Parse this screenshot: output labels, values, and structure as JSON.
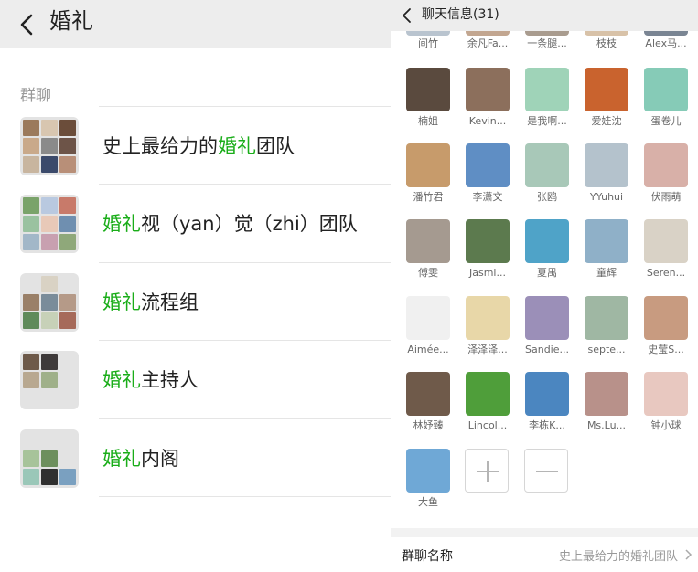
{
  "left": {
    "title": "婚礼",
    "section_label": "群聊",
    "groups": [
      {
        "pre": "史上最给力的",
        "hl": "婚礼",
        "post": "团队",
        "tiles": [
          "#9b7a5c",
          "#d8c6b0",
          "#6b4d3a",
          "#c9a98a",
          "#8a8a8a",
          "#6d5448",
          "#c8b59f",
          "#3b4a6b",
          "#b88f78"
        ]
      },
      {
        "pre": "",
        "hl": "婚礼",
        "post": "视（yan）觉（zhi）团队",
        "tiles": [
          "#7aa36a",
          "#b9c9e0",
          "#c87a6a",
          "#9ac2a0",
          "#e8c9b8",
          "#6f8fb0",
          "#a2b7c8",
          "#c8a0b0",
          "#8fa87a"
        ]
      },
      {
        "pre": "",
        "hl": "婚礼",
        "post": "流程组",
        "tiles": [
          "#e3e3e3",
          "#d9d2c4",
          "#e3e3e3",
          "#9a8068",
          "#7a8c9a",
          "#b59a88",
          "#5f8a5a",
          "#c7d1b8",
          "#a66a5a"
        ]
      },
      {
        "pre": "",
        "hl": "婚礼",
        "post": "主持人",
        "tiles": [
          "#6e5a4a",
          "#3e3a3a",
          "#e3e3e3",
          "#b8a890",
          "#9fb089",
          "#e3e3e3",
          "#e3e3e3",
          "#e3e3e3",
          "#e3e3e3"
        ]
      },
      {
        "pre": "",
        "hl": "婚礼",
        "post": "内阁",
        "tiles": [
          "#e3e3e3",
          "#e3e3e3",
          "#e3e3e3",
          "#a7c39a",
          "#6d8f5d",
          "#e3e3e3",
          "#9ac7b8",
          "#2f2f2f",
          "#7aa0c0"
        ]
      }
    ]
  },
  "right": {
    "title": "聊天信息(31)",
    "members": [
      {
        "name": "间竹",
        "color": "#b9c4cf"
      },
      {
        "name": "余凡Fa...",
        "color": "#c2a690"
      },
      {
        "name": "一条腿...",
        "color": "#a99c8f"
      },
      {
        "name": "枝枝",
        "color": "#d8c2a8"
      },
      {
        "name": "Alex马...",
        "color": "#7a8593"
      },
      {
        "name": "楠姐",
        "color": "#5a4a3e"
      },
      {
        "name": "Kevin...",
        "color": "#8c6f5c"
      },
      {
        "name": "是我啊...",
        "color": "#9fd3b8"
      },
      {
        "name": "爱娃沈",
        "color": "#c9632e"
      },
      {
        "name": "蛋卷儿",
        "color": "#86cbb7"
      },
      {
        "name": "潘竹君",
        "color": "#c79b6b"
      },
      {
        "name": "李潇文",
        "color": "#5f8ec4"
      },
      {
        "name": "张鸥",
        "color": "#a8c8b8"
      },
      {
        "name": "YYuhui",
        "color": "#b4c2cc"
      },
      {
        "name": "伏雨萌",
        "color": "#d8b0a8"
      },
      {
        "name": "傅雯",
        "color": "#a59a90"
      },
      {
        "name": "Jasmi...",
        "color": "#5c7a4e"
      },
      {
        "name": "夏禺",
        "color": "#4fa3c8"
      },
      {
        "name": "童辉",
        "color": "#8fb0c8"
      },
      {
        "name": "Seren...",
        "color": "#d9d2c6"
      },
      {
        "name": "Aimée...",
        "color": "#f0f0f0"
      },
      {
        "name": "泽泽泽...",
        "color": "#e8d7a8"
      },
      {
        "name": "Sandie...",
        "color": "#9b8fb8"
      },
      {
        "name": "septe...",
        "color": "#9fb7a3"
      },
      {
        "name": "史莹S...",
        "color": "#c89b80"
      },
      {
        "name": "林妤臻",
        "color": "#6f5a4a"
      },
      {
        "name": "Lincol...",
        "color": "#4f9e3a"
      },
      {
        "name": "李栋K...",
        "color": "#4b86c0"
      },
      {
        "name": "Ms.Lu...",
        "color": "#b8918a"
      },
      {
        "name": "钟小球",
        "color": "#e8c8c0"
      },
      {
        "name": "大鱼",
        "color": "#6fa8d6"
      }
    ],
    "bottom_label": "群聊名称",
    "bottom_value": "史上最给力的婚礼团队"
  }
}
